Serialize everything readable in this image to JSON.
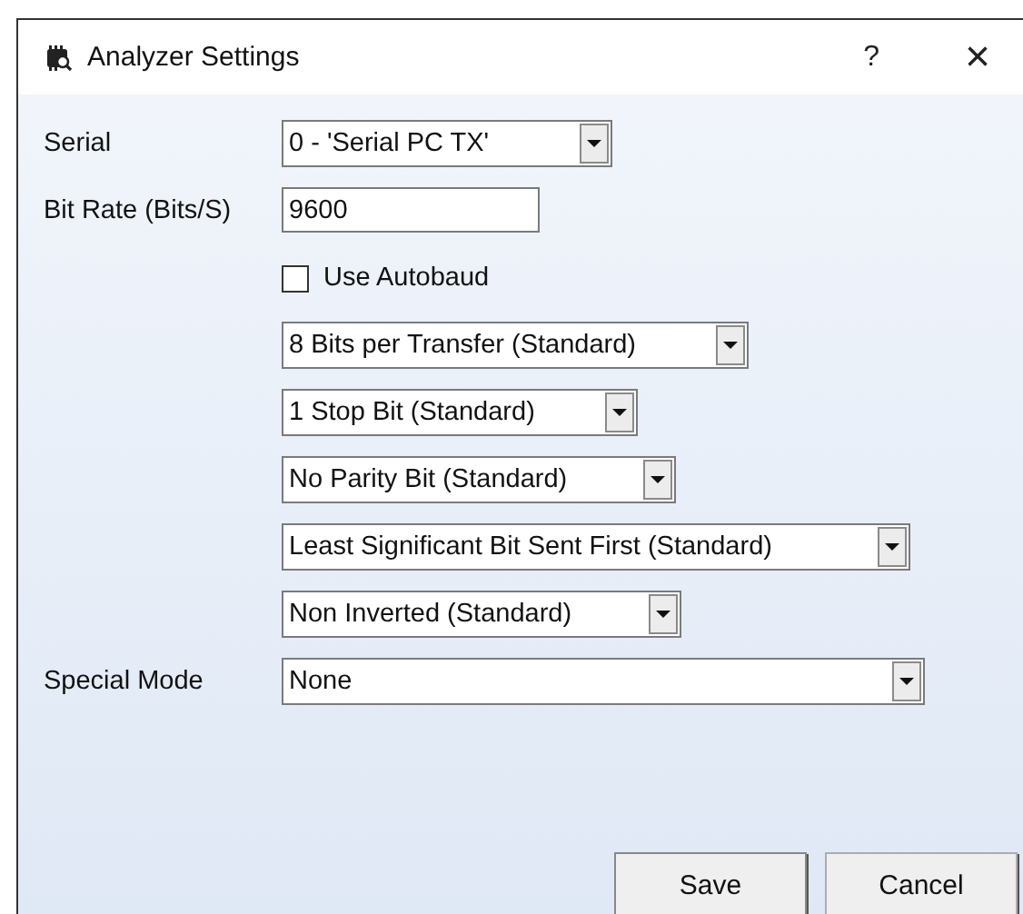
{
  "window": {
    "title": "Analyzer Settings",
    "help": "?",
    "close": "×"
  },
  "fields": [
    {
      "kind": "select",
      "label": "Serial",
      "value": "0 - 'Serial PC TX'"
    },
    {
      "kind": "text",
      "label": "Bit Rate (Bits/S)",
      "value": "9600"
    },
    {
      "kind": "checkbox",
      "text": "Use Autobaud",
      "checked": false
    },
    {
      "kind": "select",
      "value": "8 Bits per Transfer (Standard)"
    },
    {
      "kind": "select",
      "value": "1 Stop Bit (Standard)"
    },
    {
      "kind": "select",
      "value": "No Parity Bit (Standard)"
    },
    {
      "kind": "select",
      "value": "Least Significant Bit Sent First (Standard)"
    },
    {
      "kind": "select",
      "value": "Non Inverted (Standard)"
    },
    {
      "kind": "select",
      "label": "Special Mode",
      "value": "None"
    }
  ],
  "buttons": [
    "Save",
    "Cancel"
  ]
}
